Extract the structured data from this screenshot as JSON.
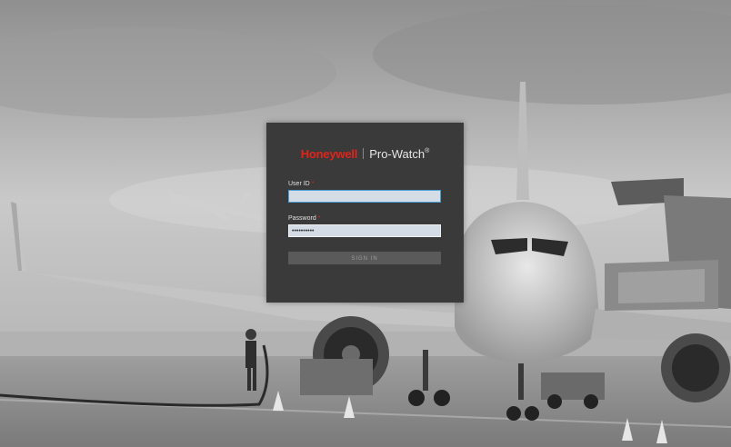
{
  "brand": {
    "company": "Honeywell",
    "product": "Pro-Watch",
    "registered_mark": "®"
  },
  "login": {
    "user_id_label": "User ID",
    "user_id_required_mark": "*",
    "user_id_value": "",
    "password_label": "Password",
    "password_required_mark": "*",
    "password_value": "••••••••••",
    "sign_in_label": "SIGN IN"
  },
  "colors": {
    "brand_red": "#e2231a",
    "panel_background": "#3a3a3a",
    "input_background": "#d4dde6",
    "focus_border": "#4aa3d8",
    "button_background": "#5a5a5a"
  }
}
